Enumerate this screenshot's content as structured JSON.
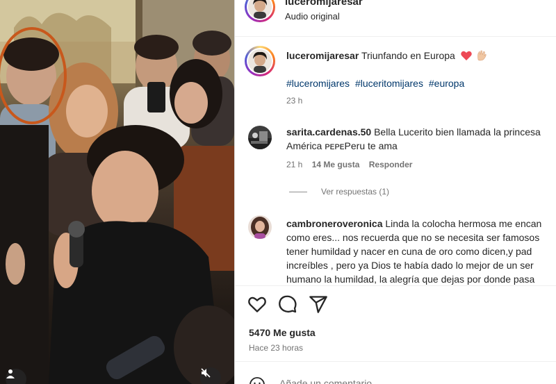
{
  "header": {
    "username": "luceromijaresar",
    "audio_label": "Audio original"
  },
  "caption": {
    "username": "luceromijaresar",
    "text": "Triunfando en Europa",
    "emojis": [
      "red-heart",
      "vulcan-salute-light-skin"
    ],
    "hashtags": [
      "#luceromijares",
      "#luceritomijares",
      "#europa"
    ],
    "time": "23 h"
  },
  "comments": [
    {
      "username": "sarita.cardenas.50",
      "line1": "Bella Lucerito bien llamada la princesa",
      "line2": "América ᴘᴇᴘᴇPeru te ama",
      "time": "21 h",
      "likes": "14 Me gusta",
      "reply_label": "Responder",
      "view_replies": "Ver respuestas (1)"
    },
    {
      "username": "cambroneroveronica",
      "line1": "Linda la colocha hermosa me encan",
      "line2": "como eres... nos recuerda que no se necesita ser famosos",
      "line3": "tener humildad y nacer en cuna de oro como dicen,y pad",
      "line4": "increíbles , pero ya Dios te había dado lo mejor de un ser",
      "line5": "humano la humildad, la alegría que dejas por donde pasa"
    }
  ],
  "actions": {
    "icons": [
      "heart-icon",
      "comment-icon",
      "share-icon"
    ],
    "likes": "5470 Me gusta",
    "posted": "Hace 23 horas"
  },
  "add_comment": {
    "placeholder": "Añade un comentario..."
  },
  "colors": {
    "link": "#00376b",
    "muted": "#737373",
    "heart_red": "#ed4956",
    "highlight_circle": "#c8581c"
  }
}
